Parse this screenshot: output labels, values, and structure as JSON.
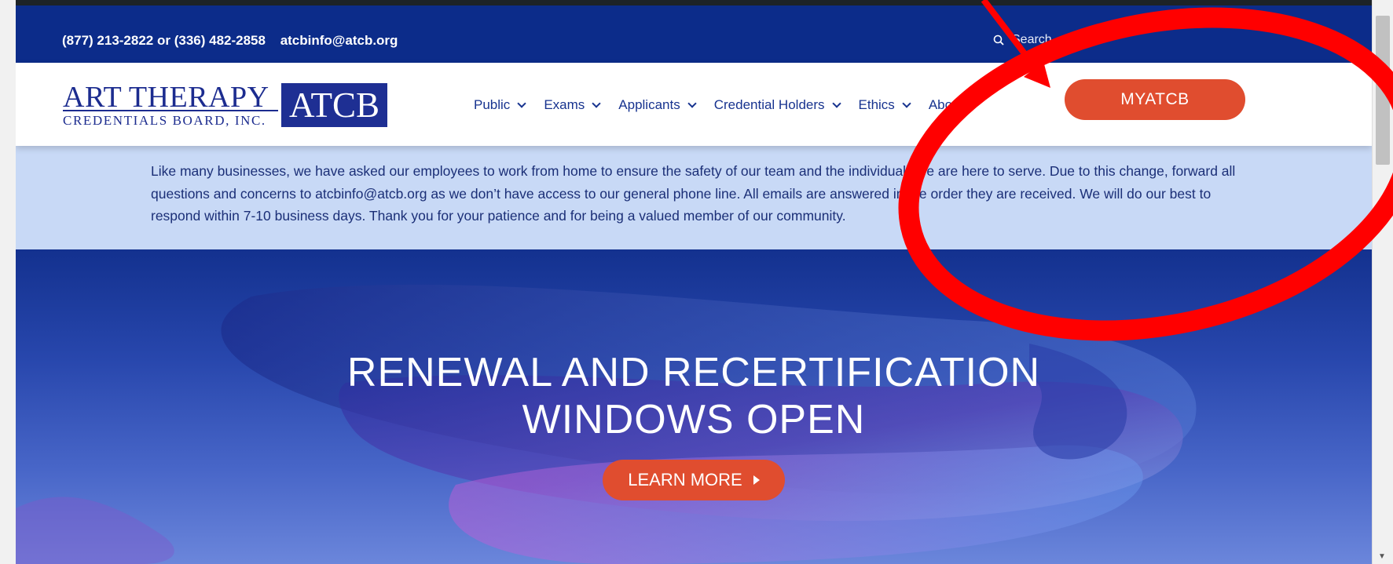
{
  "topbar": {
    "phone": "(877) 213-2822 or (336) 482-2858",
    "email": "atcbinfo@atcb.org",
    "search_placeholder": "Search..."
  },
  "logo": {
    "line1": "ART THERAPY",
    "line2": "CREDENTIALS BOARD, INC.",
    "box": "ATCB"
  },
  "nav": {
    "items": [
      {
        "label": "Public"
      },
      {
        "label": "Exams"
      },
      {
        "label": "Applicants"
      },
      {
        "label": "Credential Holders"
      },
      {
        "label": "Ethics"
      },
      {
        "label": "About"
      }
    ],
    "cta_label": "MYATCB"
  },
  "notice": {
    "text": "Like many businesses, we have asked our employees to work from home to ensure the safety of our team and the individuals we are here to serve. Due to this change, forward all questions and concerns to atcbinfo@atcb.org as we don’t have access to our general phone line. All emails are answered in the order they are received. We will do our best to respond within 7-10 business days. Thank you for your patience and for being a valued member of our community."
  },
  "hero": {
    "title_line1": "RENEWAL AND RECERTIFICATION",
    "title_line2": "WINDOWS OPEN",
    "button_label": "LEARN MORE"
  },
  "colors": {
    "brand_blue": "#0c2c8a",
    "accent_orange": "#e04d2f",
    "notice_bg": "#c8d9f6",
    "annotation_red": "#ff0000"
  }
}
